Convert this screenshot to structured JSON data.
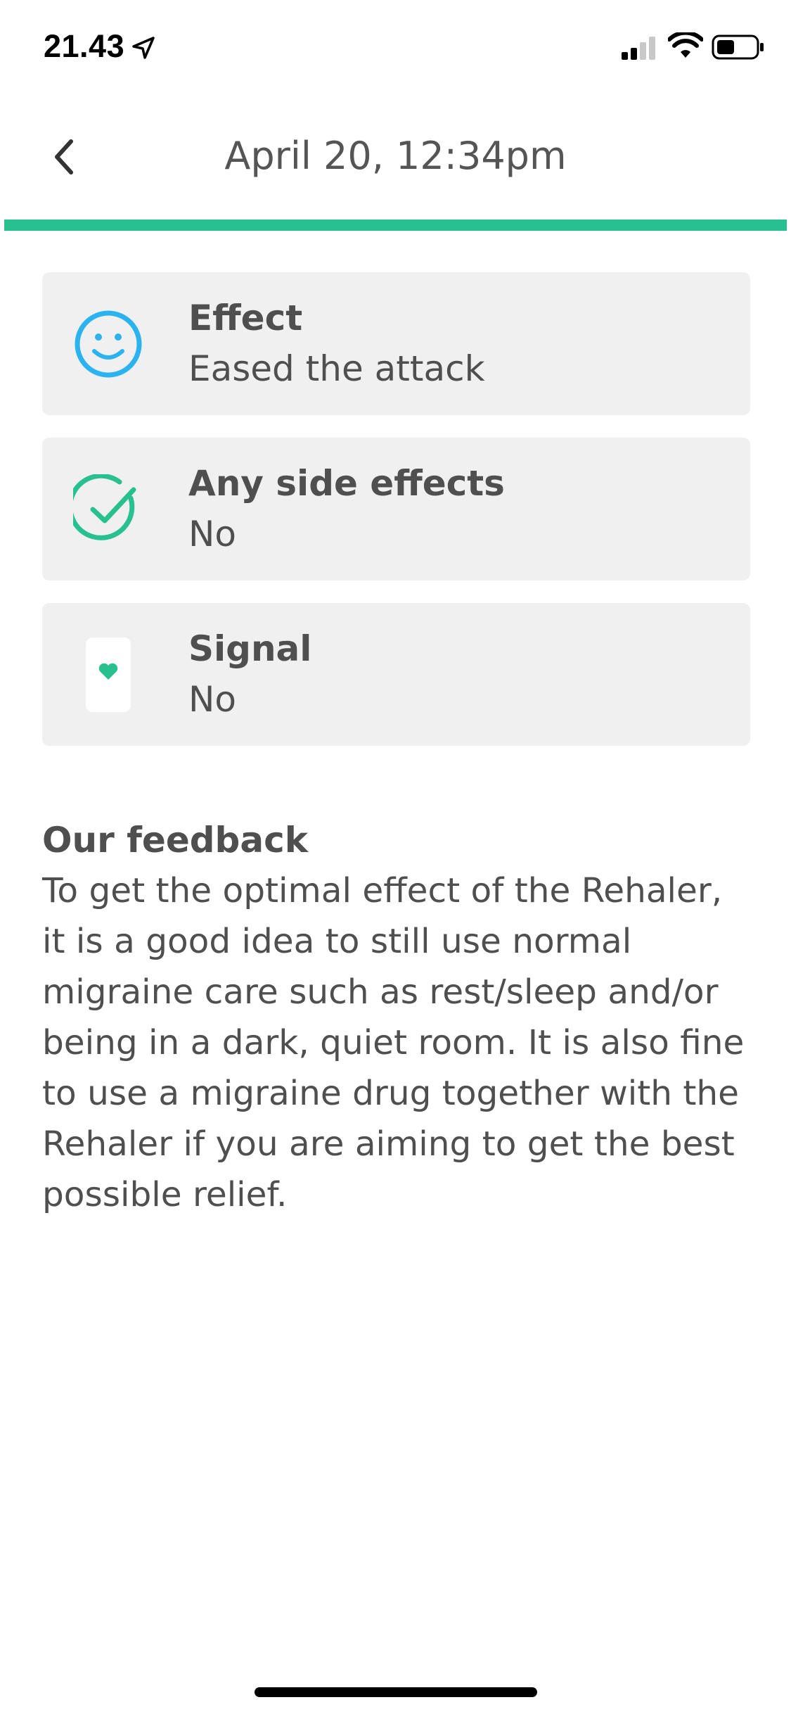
{
  "status_bar": {
    "time": "21.43",
    "icons": [
      "location-arrow-icon",
      "cellular-signal-icon",
      "wifi-icon",
      "battery-icon"
    ]
  },
  "header": {
    "title": "April 20, 12:34pm",
    "back_icon": "chevron-left-icon"
  },
  "colors": {
    "accent": "#28c08f",
    "effect_icon": "#2bb3f0",
    "check_icon": "#28c08f",
    "card_bg": "#f0f0f0",
    "text": "#4f4f4f"
  },
  "cards": [
    {
      "title": "Effect",
      "value": "Eased the attack",
      "icon": "smiley-face-icon"
    },
    {
      "title": "Any side effects",
      "value": "No",
      "icon": "check-circle-icon"
    },
    {
      "title": "Signal",
      "value": "No",
      "icon": "device-heart-icon"
    }
  ],
  "feedback": {
    "heading": "Our feedback",
    "body": "To get the optimal effect of the Rehaler, it is a good idea to still use normal migraine care such as rest/sleep and/or being in a dark, quiet room. It is also fine to use a migraine drug together with the Rehaler if you are aiming to get the best possible relief."
  }
}
